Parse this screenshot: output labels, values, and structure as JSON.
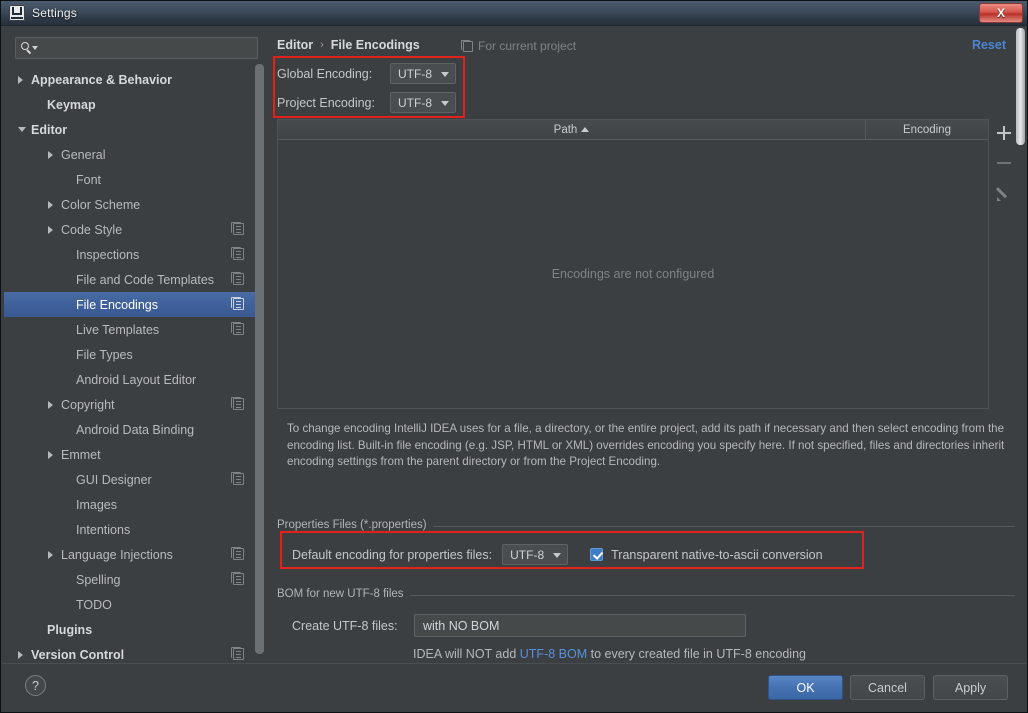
{
  "window": {
    "title": "Settings",
    "app_icon": "intellij-idea-icon",
    "close_label": "X"
  },
  "search": {
    "value": "",
    "placeholder": "",
    "icon": "search-icon"
  },
  "sidebar": {
    "items": [
      {
        "label": "Appearance & Behavior",
        "indent": 12,
        "arrow": "right",
        "bold": true,
        "copy": false,
        "selected": false
      },
      {
        "label": "Keymap",
        "indent": 28,
        "arrow": "none",
        "bold": true,
        "copy": false,
        "selected": false
      },
      {
        "label": "Editor",
        "indent": 12,
        "arrow": "down",
        "bold": true,
        "copy": false,
        "selected": false
      },
      {
        "label": "General",
        "indent": 42,
        "arrow": "right",
        "bold": false,
        "copy": false,
        "selected": false
      },
      {
        "label": "Font",
        "indent": 57,
        "arrow": "none",
        "bold": false,
        "copy": false,
        "selected": false
      },
      {
        "label": "Color Scheme",
        "indent": 42,
        "arrow": "right",
        "bold": false,
        "copy": false,
        "selected": false
      },
      {
        "label": "Code Style",
        "indent": 42,
        "arrow": "right",
        "bold": false,
        "copy": true,
        "selected": false
      },
      {
        "label": "Inspections",
        "indent": 57,
        "arrow": "none",
        "bold": false,
        "copy": true,
        "selected": false
      },
      {
        "label": "File and Code Templates",
        "indent": 57,
        "arrow": "none",
        "bold": false,
        "copy": true,
        "selected": false
      },
      {
        "label": "File Encodings",
        "indent": 57,
        "arrow": "none",
        "bold": false,
        "copy": true,
        "selected": true
      },
      {
        "label": "Live Templates",
        "indent": 57,
        "arrow": "none",
        "bold": false,
        "copy": true,
        "selected": false
      },
      {
        "label": "File Types",
        "indent": 57,
        "arrow": "none",
        "bold": false,
        "copy": false,
        "selected": false
      },
      {
        "label": "Android Layout Editor",
        "indent": 57,
        "arrow": "none",
        "bold": false,
        "copy": false,
        "selected": false
      },
      {
        "label": "Copyright",
        "indent": 42,
        "arrow": "right",
        "bold": false,
        "copy": true,
        "selected": false
      },
      {
        "label": "Android Data Binding",
        "indent": 57,
        "arrow": "none",
        "bold": false,
        "copy": false,
        "selected": false
      },
      {
        "label": "Emmet",
        "indent": 42,
        "arrow": "right",
        "bold": false,
        "copy": false,
        "selected": false
      },
      {
        "label": "GUI Designer",
        "indent": 57,
        "arrow": "none",
        "bold": false,
        "copy": true,
        "selected": false
      },
      {
        "label": "Images",
        "indent": 57,
        "arrow": "none",
        "bold": false,
        "copy": false,
        "selected": false
      },
      {
        "label": "Intentions",
        "indent": 57,
        "arrow": "none",
        "bold": false,
        "copy": false,
        "selected": false
      },
      {
        "label": "Language Injections",
        "indent": 42,
        "arrow": "right",
        "bold": false,
        "copy": true,
        "selected": false
      },
      {
        "label": "Spelling",
        "indent": 57,
        "arrow": "none",
        "bold": false,
        "copy": true,
        "selected": false
      },
      {
        "label": "TODO",
        "indent": 57,
        "arrow": "none",
        "bold": false,
        "copy": false,
        "selected": false
      },
      {
        "label": "Plugins",
        "indent": 28,
        "arrow": "none",
        "bold": true,
        "copy": false,
        "selected": false
      },
      {
        "label": "Version Control",
        "indent": 12,
        "arrow": "right",
        "bold": true,
        "copy": true,
        "selected": false
      }
    ]
  },
  "header": {
    "breadcrumb_parent": "Editor",
    "breadcrumb_sep": "›",
    "breadcrumb_current": "File Encodings",
    "scope_label": "For current project",
    "scope_icon": "project-scope-icon",
    "reset_label": "Reset"
  },
  "encodings": {
    "global_label": "Global Encoding:",
    "global_value": "UTF-8",
    "project_label": "Project Encoding:",
    "project_value": "UTF-8"
  },
  "table": {
    "columns": [
      "Path",
      "Encoding"
    ],
    "sort_column": "Path",
    "sort_direction": "asc",
    "rows": [],
    "empty_text": "Encodings are not configured",
    "toolbar": {
      "add": "add-row-button",
      "remove": "remove-row-button",
      "edit": "edit-row-button"
    }
  },
  "description": "To change encoding IntelliJ IDEA uses for a file, a directory, or the entire project, add its path if necessary and then select encoding from the encoding list. Built-in file encoding (e.g. JSP, HTML or XML) overrides encoding you specify here. If not specified, files and directories inherit encoding settings from the parent directory or from the Project Encoding.",
  "properties_group": {
    "title": "Properties Files (*.properties)",
    "default_encoding_label": "Default encoding for properties files:",
    "default_encoding_value": "UTF-8",
    "transparent_label": "Transparent native-to-ascii conversion",
    "transparent_checked": true
  },
  "bom_group": {
    "title": "BOM for new UTF-8 files",
    "create_label": "Create UTF-8 files:",
    "create_value": "with NO BOM",
    "note_prefix": "IDEA will NOT add ",
    "note_link": "UTF-8 BOM",
    "note_suffix": " to every created file in UTF-8 encoding"
  },
  "footer": {
    "help_label": "?",
    "ok_label": "OK",
    "cancel_label": "Cancel",
    "apply_label": "Apply"
  },
  "colors": {
    "window_bg": "#3c3f41",
    "accent_blue": "#4a84d6",
    "selection_blue": "#3f609a",
    "annotation_red": "#e2211c",
    "link_blue": "#5a8fdb",
    "checkbox_blue": "#3e7cc4"
  }
}
